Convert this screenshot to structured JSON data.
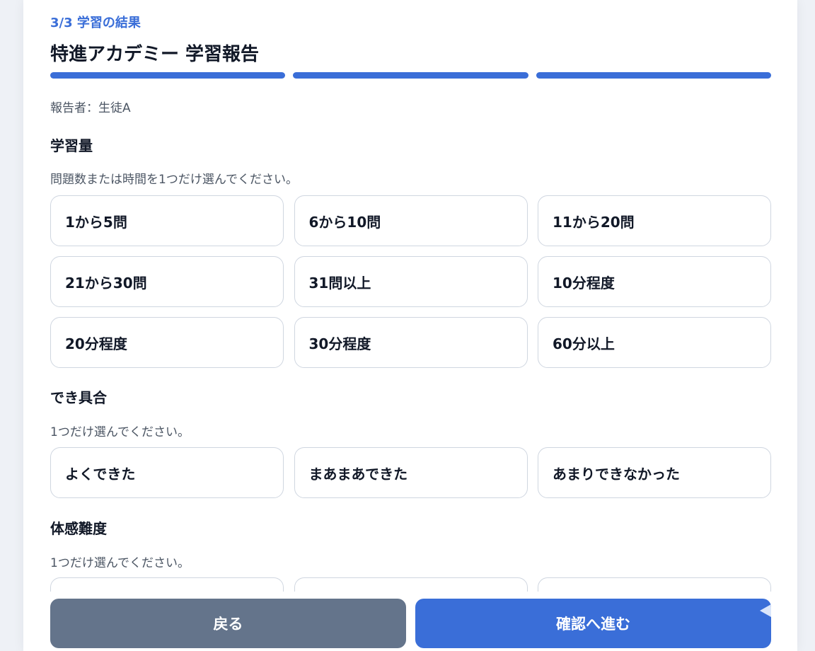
{
  "header": {
    "step": "3/3 学習の結果",
    "title": "特進アカデミー 学習報告",
    "progress_segments": 3,
    "progress_completed": 3
  },
  "reporter": "報告者：生徒A",
  "sections": {
    "amount": {
      "title": "学習量",
      "hint": "問題数または時間を1つだけ選んでください。",
      "options": [
        "1から5問",
        "6から10問",
        "11から20問",
        "21から30問",
        "31問以上",
        "10分程度",
        "20分程度",
        "30分程度",
        "60分以上"
      ]
    },
    "performance": {
      "title": "でき具合",
      "hint": "1つだけ選んでください。",
      "options": [
        "よくできた",
        "まあまあできた",
        "あまりできなかった"
      ]
    },
    "difficulty": {
      "title": "体感難度",
      "hint": "1つだけ選んでください。",
      "options": [
        "",
        "",
        ""
      ]
    }
  },
  "footer": {
    "back_label": "戻る",
    "next_label": "確認へ進む"
  },
  "colors": {
    "accent": "#3a6ed8",
    "back_button": "#64748b",
    "option_border": "#cfd6e0",
    "background": "#eef1f6"
  }
}
